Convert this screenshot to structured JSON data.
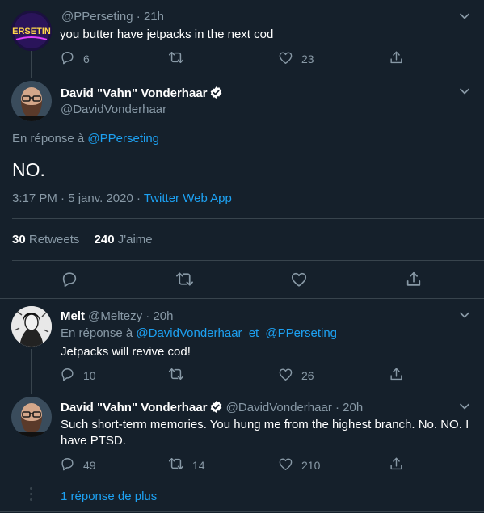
{
  "colors": {
    "background": "#15202b",
    "text": "#ffffff",
    "muted": "#8899a6",
    "accent": "#1da1f2",
    "border": "#38444d"
  },
  "tweet1": {
    "handle": "@PPerseting",
    "time": "21h",
    "text": "you butter have jetpacks in the next cod",
    "avatar_text": "ERSETIN",
    "replies": "6",
    "likes": "23"
  },
  "main": {
    "name": "David \"Vahn\" Vonderhaar",
    "handle": "@DavidVonderhaar",
    "reply_prefix": "En réponse à",
    "reply_to": "@PPerseting",
    "text": "NO.",
    "timestamp": "3:17 PM · 5 janv. 2020 · ",
    "source": "Twitter Web App",
    "retweets_count": "30",
    "retweets_label": "Retweets",
    "likes_count": "240",
    "likes_label": "J'aime"
  },
  "reply1": {
    "name": "Melt",
    "handle": "@Meltezy",
    "time": "20h",
    "reply_prefix": "En réponse à",
    "reply_to1": "@DavidVonderhaar",
    "reply_and": "et",
    "reply_to2": "@PPerseting",
    "text": "Jetpacks will revive cod!",
    "replies": "10",
    "likes": "26"
  },
  "reply2": {
    "name": "David \"Vahn\" Vonderhaar",
    "handle": "@DavidVonderhaar",
    "time": "20h",
    "text_line1": "Such short-term memories. You hung me from the highest branch. No. NO. I",
    "text_line2": "have PTSD.",
    "replies": "49",
    "retweets": "14",
    "likes": "210"
  },
  "more_replies": "1 réponse de plus",
  "icons": [
    "reply-icon",
    "retweet-icon",
    "like-icon",
    "share-icon",
    "chevron-down-icon",
    "verified-icon"
  ]
}
